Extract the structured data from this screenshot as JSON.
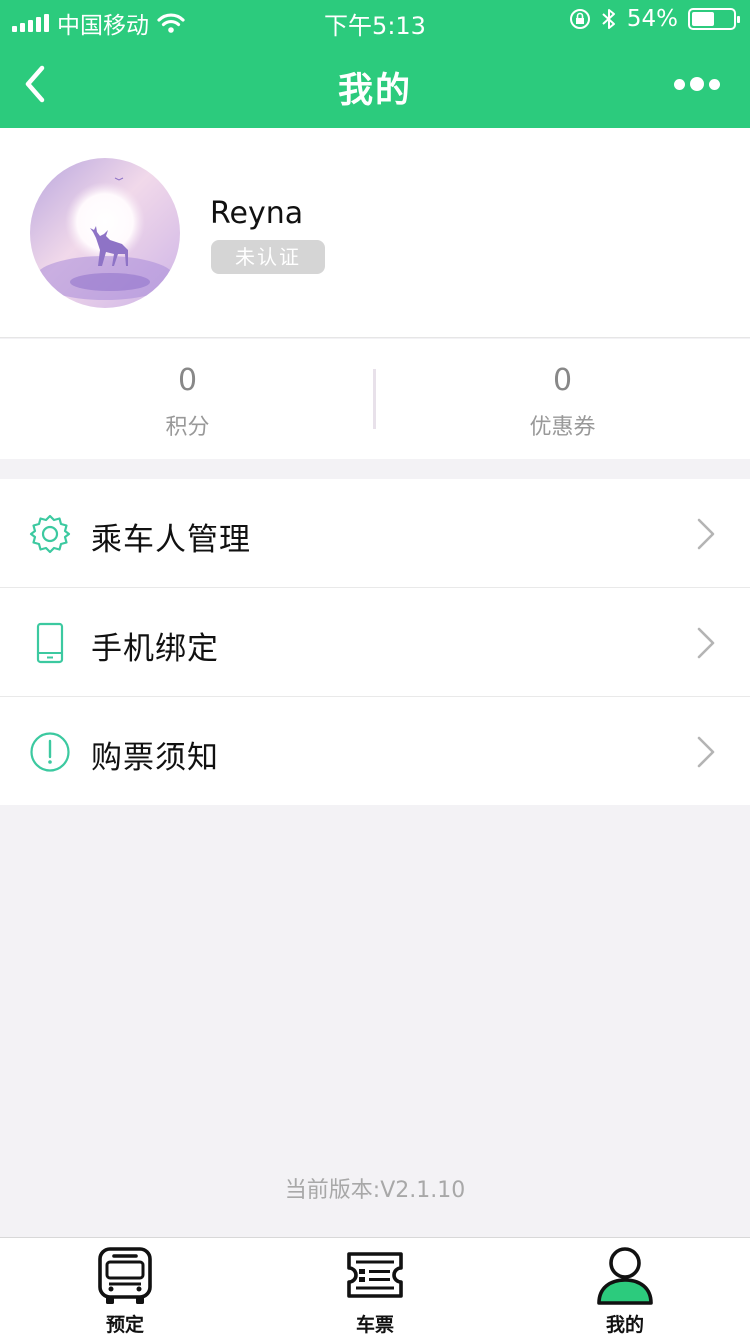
{
  "status_bar": {
    "carrier": "中国移动",
    "time": "下午5:13",
    "battery_text": "54%",
    "battery_level": 0.54
  },
  "header": {
    "title": "我的",
    "back_icon": "chevron-left-icon",
    "more_icon": "more-dots-icon"
  },
  "profile": {
    "username": "Reyna",
    "verification_badge": "未认证"
  },
  "stats": [
    {
      "value": "0",
      "label": "积分"
    },
    {
      "value": "0",
      "label": "优惠券"
    }
  ],
  "menu": [
    {
      "label": "乘车人管理",
      "icon": "gear-icon"
    },
    {
      "label": "手机绑定",
      "icon": "phone-icon"
    },
    {
      "label": "购票须知",
      "icon": "info-circle-icon"
    }
  ],
  "footer": {
    "version_text": "当前版本:V2.1.10"
  },
  "tabbar": [
    {
      "label": "预定",
      "icon": "bus-icon",
      "active": false
    },
    {
      "label": "车票",
      "icon": "ticket-icon",
      "active": false
    },
    {
      "label": "我的",
      "icon": "user-icon",
      "active": true
    }
  ],
  "colors": {
    "accent": "#2ccb7d",
    "icon_teal": "#3cc9a0"
  }
}
